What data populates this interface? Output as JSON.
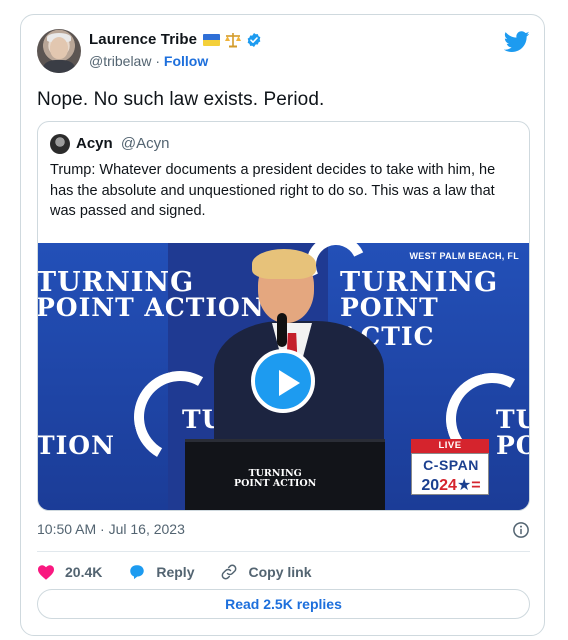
{
  "author": {
    "display_name": "Laurence Tribe",
    "handle": "@tribelaw",
    "follow_label": "Follow",
    "separator": "·"
  },
  "tweet": {
    "text": "Nope. No such law exists. Period."
  },
  "quoted_tweet": {
    "display_name": "Acyn",
    "handle": "@Acyn",
    "text": "Trump: Whatever documents a president decides to take with him, he has the absolute and unquestioned right to do so. This was a law that was passed and signed.",
    "video": {
      "location_caption": "WEST PALM BEACH, FL",
      "banner_left_line1": "TURNING",
      "banner_left_line2": "POINT ACTION",
      "banner_right_line1": "TURNING",
      "banner_right_line2": "POINT ACTIC",
      "lower_left": "TION",
      "lower_mid": "TU",
      "lower_right_top": "TU",
      "lower_right_bottom": "PO",
      "podium_line1": "TURNING",
      "podium_line2": "POINT ACTION",
      "live_label": "LIVE",
      "cspan_label": "C-SPAN",
      "cspan_year_prefix": "20",
      "cspan_year_suffix": "24"
    }
  },
  "meta": {
    "timestamp": "10:50 AM · Jul 16, 2023"
  },
  "actions": {
    "like_count": "20.4K",
    "reply_label": "Reply",
    "copy_link_label": "Copy link"
  },
  "footer": {
    "read_replies_label": "Read 2.5K replies"
  },
  "colors": {
    "twitter_blue": "#1d9bf0",
    "link_blue": "#1d6fdc",
    "like_pink": "#f91880",
    "muted_text": "#536471"
  },
  "icons": [
    "ukraine-flag-icon",
    "scales-icon",
    "verified-badge-icon",
    "twitter-bird-icon",
    "play-icon",
    "info-icon",
    "heart-icon",
    "reply-bubble-icon",
    "link-icon"
  ]
}
